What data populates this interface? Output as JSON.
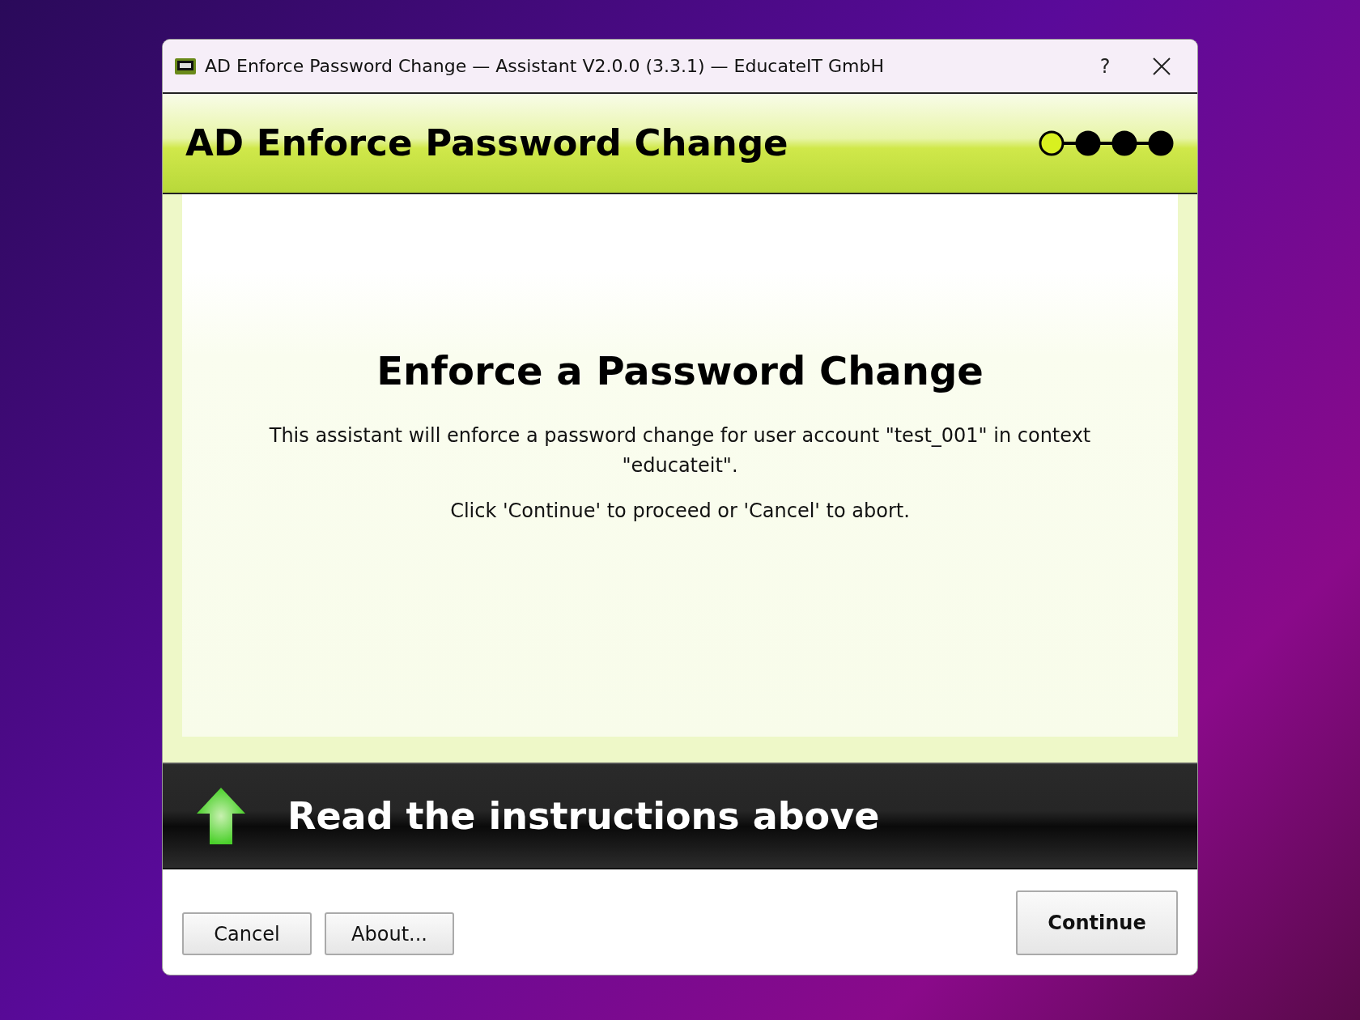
{
  "window": {
    "title": "AD Enforce Password Change — Assistant V2.0.0 (3.3.1) — EducateIT GmbH",
    "help": "?"
  },
  "header": {
    "title": "AD Enforce Password Change",
    "steps": [
      {
        "current": true
      },
      {
        "current": false
      },
      {
        "current": false
      },
      {
        "current": false
      }
    ]
  },
  "content": {
    "heading": "Enforce a Password Change",
    "paragraphs": [
      "This assistant will enforce a password change for user account \"test_001\" in context \"educateit\".",
      "Click 'Continue' to proceed or 'Cancel' to abort."
    ]
  },
  "banner": {
    "text": "Read the instructions above"
  },
  "buttons": [
    {
      "label": "Cancel",
      "primary": false
    },
    {
      "label": "About...",
      "primary": false
    },
    {
      "label": "Continue",
      "primary": true
    }
  ]
}
